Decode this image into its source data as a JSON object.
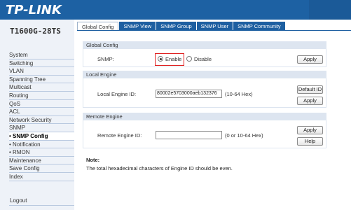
{
  "header": {
    "logo": "TP-LINK"
  },
  "sidebar": {
    "model": "T1600G-28TS",
    "items": [
      {
        "label": "System"
      },
      {
        "label": "Switching"
      },
      {
        "label": "VLAN"
      },
      {
        "label": "Spanning Tree"
      },
      {
        "label": "Multicast"
      },
      {
        "label": "Routing"
      },
      {
        "label": "QoS"
      },
      {
        "label": "ACL"
      },
      {
        "label": "Network Security"
      },
      {
        "label": "SNMP"
      },
      {
        "label": "• SNMP Config"
      },
      {
        "label": "• Notification"
      },
      {
        "label": "• RMON"
      },
      {
        "label": "Maintenance"
      },
      {
        "label": "Save Config"
      },
      {
        "label": "Index"
      }
    ],
    "logout": "Logout"
  },
  "tabs": [
    {
      "label": "Global Config"
    },
    {
      "label": "SNMP View"
    },
    {
      "label": "SNMP Group"
    },
    {
      "label": "SNMP User"
    },
    {
      "label": "SNMP Community"
    }
  ],
  "global_config": {
    "title": "Global Config",
    "snmp_label": "SNMP:",
    "enable_label": "Enable",
    "disable_label": "Disable",
    "selected": "Enable",
    "apply": "Apply"
  },
  "local_engine": {
    "title": "Local Engine",
    "id_label": "Local Engine ID:",
    "id_value": "80002e5703000aeb132376",
    "hint": "(10-64 Hex)",
    "default_button": "Default ID",
    "apply": "Apply"
  },
  "remote_engine": {
    "title": "Remote Engine",
    "id_label": "Remote Engine ID:",
    "id_value": "",
    "hint": "(0 or 10-64 Hex)",
    "apply": "Apply",
    "help": "Help"
  },
  "note": {
    "title": "Note:",
    "text": "The total hexadecimal characters of Engine ID should be even."
  },
  "colors": {
    "brand_blue": "#1d61a3",
    "section_bg": "#dde5f0",
    "highlight_red": "#e02020"
  }
}
